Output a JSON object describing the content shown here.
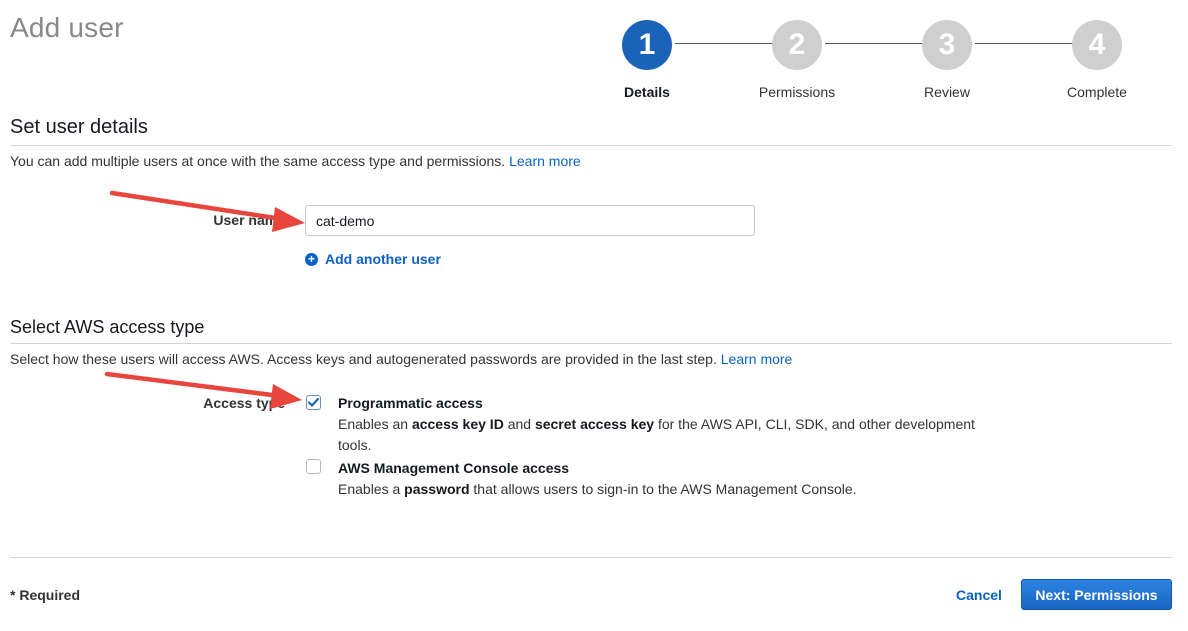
{
  "page": {
    "title": "Add user"
  },
  "stepper": {
    "steps": [
      {
        "number": "1",
        "label": "Details",
        "active": true
      },
      {
        "number": "2",
        "label": "Permissions",
        "active": false
      },
      {
        "number": "3",
        "label": "Review",
        "active": false
      },
      {
        "number": "4",
        "label": "Complete",
        "active": false
      }
    ]
  },
  "user_details": {
    "title": "Set user details",
    "description": "You can add multiple users at once with the same access type and permissions.",
    "learn_more": "Learn more",
    "user_name_label": "User name",
    "user_name_value": "cat-demo",
    "add_another_user": "Add another user"
  },
  "access_type": {
    "title": "Select AWS access type",
    "description": "Select how these users will access AWS. Access keys and autogenerated passwords are provided in the last step.",
    "learn_more": "Learn more",
    "label": "Access type",
    "options": [
      {
        "title": "Programmatic access",
        "checked": true,
        "desc_1": "Enables an ",
        "desc_bold_1": "access key ID",
        "desc_2": " and ",
        "desc_bold_2": "secret access key",
        "desc_3": " for the AWS API, CLI, SDK, and other development tools."
      },
      {
        "title": "AWS Management Console access",
        "checked": false,
        "desc_1": "Enables a ",
        "desc_bold_1": "password",
        "desc_2": " that allows users to sign-in to the AWS Management Console."
      }
    ]
  },
  "footer": {
    "required": "* Required",
    "cancel": "Cancel",
    "next": "Next: Permissions"
  },
  "colors": {
    "accent": "#1a63b8",
    "link": "#0b62c4",
    "annotation_arrow": "#e8453c"
  }
}
